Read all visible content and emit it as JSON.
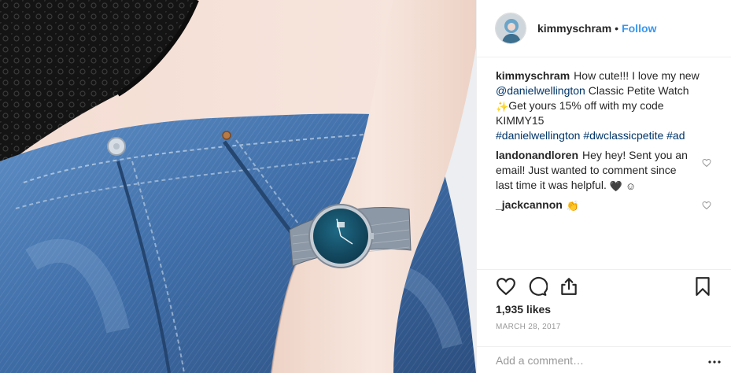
{
  "post": {
    "username": "kimmyschram",
    "dot": "•",
    "follow_label": "Follow",
    "photo_subject": "woman wearing blue denim jeans and a black lace top, showing a Daniel Wellington watch with blue dial and mesh strap"
  },
  "caption": {
    "username": "kimmyschram",
    "text_1": "How cute!!! I love my new ",
    "mention": "@danielwellington",
    "text_2": " Classic Petite Watch ",
    "emoji": "✨",
    "text_3": "Get yours 15% off with my code KIMMY15",
    "hashtags": [
      "#danielwellington",
      "#dwclassicpetite",
      "#ad"
    ]
  },
  "comments": [
    {
      "username": "landonandloren",
      "text": "Hey hey! Sent you an email! Just wanted to comment since last time it was helpful. ",
      "emojis": [
        "🖤",
        "☺"
      ]
    },
    {
      "username": "_jackcannon",
      "text": "",
      "emojis": [
        "👏"
      ]
    }
  ],
  "stats": {
    "likes": "1,935 likes",
    "date": "MARCH 28, 2017"
  },
  "add_comment": {
    "placeholder": "Add a comment…"
  },
  "icons": {
    "like": "heart-icon",
    "comment": "comment-bubble-icon",
    "share": "share-icon",
    "save": "bookmark-icon",
    "more": "more-options-icon"
  },
  "colors": {
    "follow": "#3897f0",
    "link": "#003569",
    "text": "#262626",
    "muted": "#999999",
    "border": "#efefef"
  }
}
